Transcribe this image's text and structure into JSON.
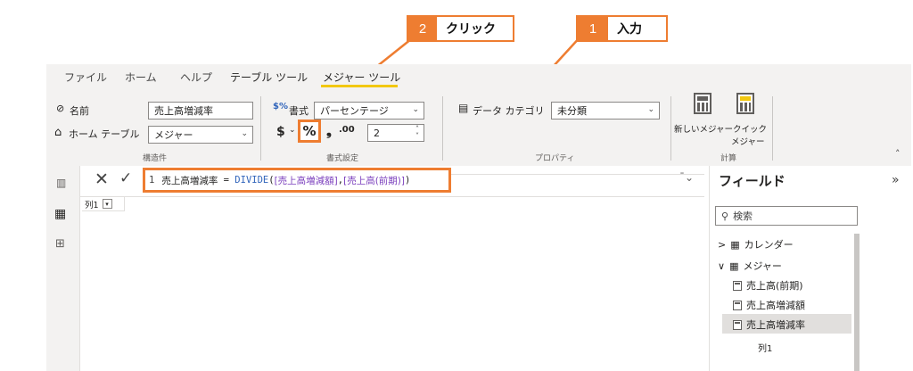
{
  "callouts": {
    "step1": {
      "num": "1",
      "text": "入力"
    },
    "step2": {
      "num": "2",
      "text": "クリック"
    }
  },
  "tabs": [
    {
      "label": "ファイル"
    },
    {
      "label": "ホーム"
    },
    {
      "label": "ヘルプ"
    },
    {
      "label": "テーブル ツール"
    },
    {
      "label": "メジャー ツール",
      "active": true
    }
  ],
  "ribbon": {
    "structure": {
      "name_label": "名前",
      "name_value": "売上高増減率",
      "home_table_label": "ホーム テーブル",
      "home_table_value": "メジャー",
      "group_label": "構造件"
    },
    "format": {
      "format_label": "書式",
      "format_value": "パーセンテージ",
      "currency_symbol": "$",
      "percent_symbol": "%",
      "comma_symbol": "❟",
      "decimals_symbol": ".00",
      "decimals_value": "2",
      "group_label": "書式設定"
    },
    "properties": {
      "data_category_label": "データ カテゴリ",
      "data_category_value": "未分類",
      "group_label": "プロパティ"
    },
    "calculation": {
      "new_measure": "新しいメジャー",
      "quick_measure_line1": "クイック",
      "quick_measure_line2": "メジャー",
      "group_label": "計算"
    }
  },
  "formula": {
    "line_number": "1",
    "measure_name": "売上高増減率",
    "equals": " = ",
    "function": "DIVIDE",
    "open": "(",
    "arg1": "[売上高増減額]",
    "comma": ",",
    "arg2": "[売上高(前期)]",
    "close": ")"
  },
  "canvas": {
    "column_header": "列1"
  },
  "fields_pane": {
    "title": "フィールド",
    "search_placeholder": "検索",
    "tables": [
      {
        "name": "カレンダー",
        "expanded": false
      },
      {
        "name": "メジャー",
        "expanded": true
      }
    ],
    "measures": [
      "売上高(前期)",
      "売上高増減額",
      "売上高増減率"
    ],
    "column": "列1",
    "selected_measure": "売上高増減率"
  },
  "colors": {
    "accent_orange": "#ee7d31",
    "tab_underline": "#f2c811",
    "ribbon_bg": "#f3f2f1",
    "dax_function": "#3165bb",
    "dax_reference": "#7a3ebd"
  }
}
